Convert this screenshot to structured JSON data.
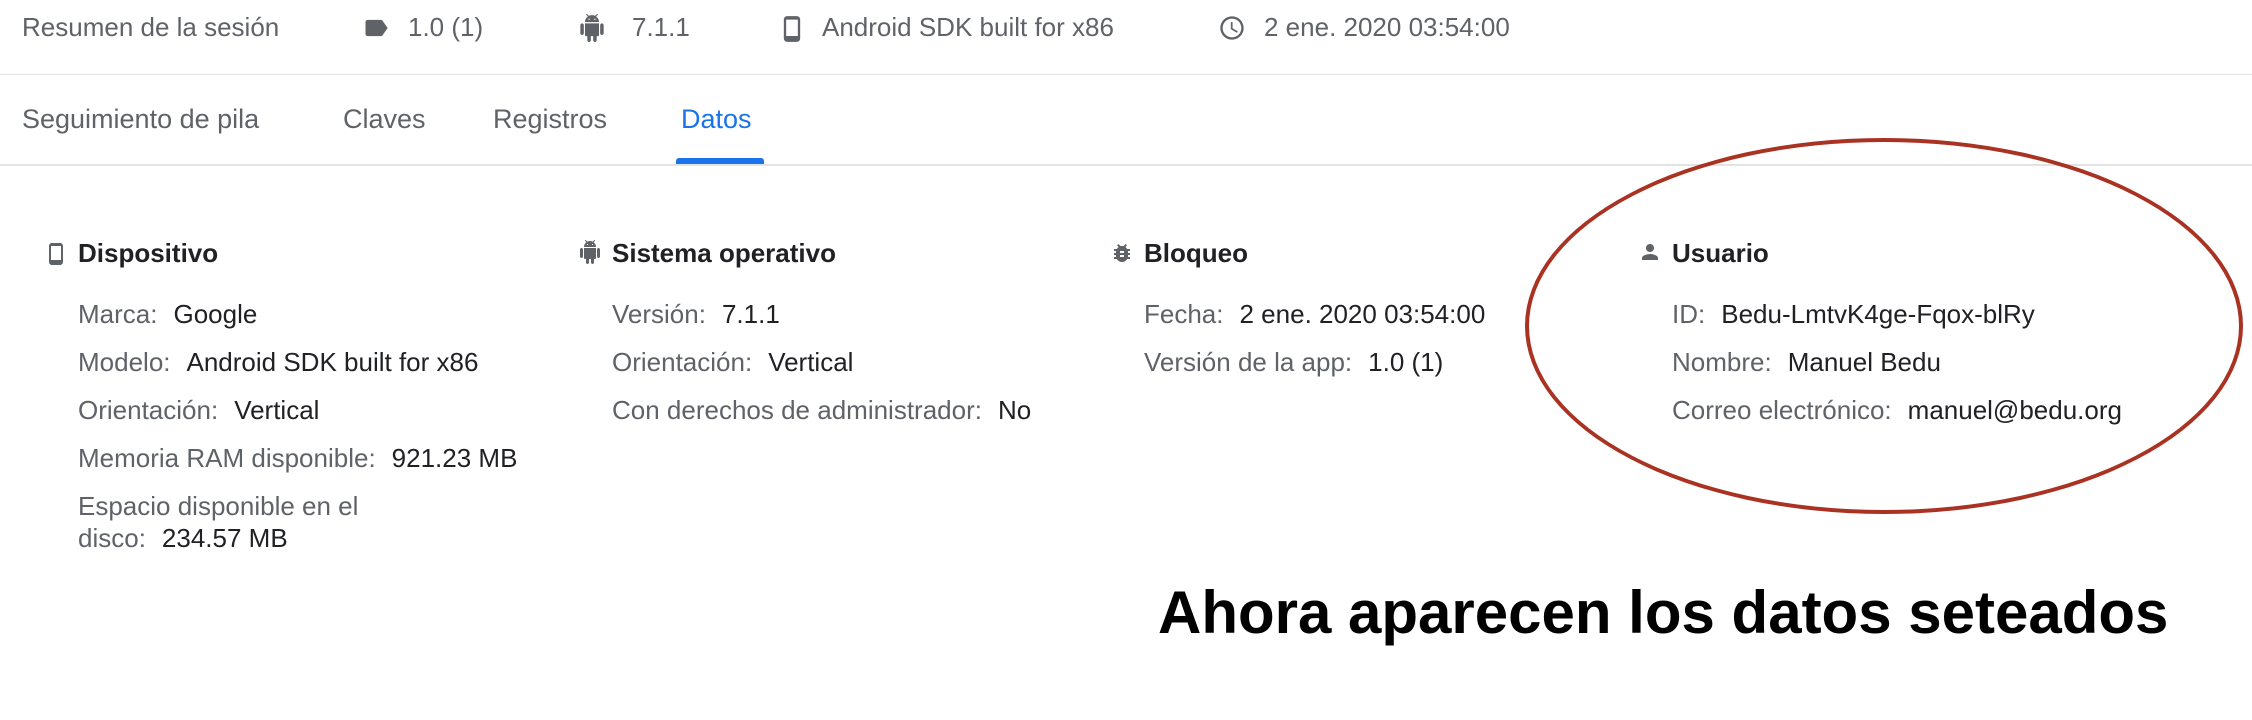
{
  "summary": {
    "title": "Resumen de la sesión",
    "items": [
      {
        "icon": "tag-icon",
        "text": "1.0 (1)"
      },
      {
        "icon": "android-icon",
        "text": "7.1.1"
      },
      {
        "icon": "phone-icon",
        "text": "Android SDK built for x86"
      },
      {
        "icon": "clock-icon",
        "text": "2 ene. 2020 03:54:00"
      }
    ]
  },
  "tabs": [
    {
      "label": "Seguimiento de pila",
      "active": false
    },
    {
      "label": "Claves",
      "active": false
    },
    {
      "label": "Registros",
      "active": false
    },
    {
      "label": "Datos",
      "active": true
    }
  ],
  "sections": {
    "device": {
      "title": "Dispositivo",
      "icon": "phone-icon",
      "rows": [
        {
          "key": "Marca:",
          "value": "Google"
        },
        {
          "key": "Modelo:",
          "value": "Android SDK built for x86"
        },
        {
          "key": "Orientación:",
          "value": "Vertical"
        },
        {
          "key": "Memoria RAM disponible:",
          "value": "921.23 MB"
        },
        {
          "key": "Espacio disponible en el disco:",
          "value": "234.57 MB"
        }
      ]
    },
    "os": {
      "title": "Sistema operativo",
      "icon": "android-icon",
      "rows": [
        {
          "key": "Versión:",
          "value": "7.1.1"
        },
        {
          "key": "Orientación:",
          "value": "Vertical"
        },
        {
          "key": "Con derechos de administrador:",
          "value": "No"
        }
      ]
    },
    "crash": {
      "title": "Bloqueo",
      "icon": "bug-icon",
      "rows": [
        {
          "key": "Fecha:",
          "value": "2 ene. 2020 03:54:00"
        },
        {
          "key": "Versión de la app:",
          "value": "1.0 (1)"
        }
      ]
    },
    "user": {
      "title": "Usuario",
      "icon": "person-icon",
      "rows": [
        {
          "key": "ID:",
          "value": "Bedu-LmtvK4ge-Fqox-blRy"
        },
        {
          "key": "Nombre:",
          "value": "Manuel Bedu"
        },
        {
          "key": "Correo electrónico:",
          "value": "manuel@bedu.org"
        }
      ]
    }
  },
  "annotation": {
    "caption": "Ahora aparecen los datos seteados",
    "highlight_color": "#a93222"
  },
  "colors": {
    "accent": "#1a73e8",
    "muted_text": "#5f6368",
    "text": "#202124"
  }
}
